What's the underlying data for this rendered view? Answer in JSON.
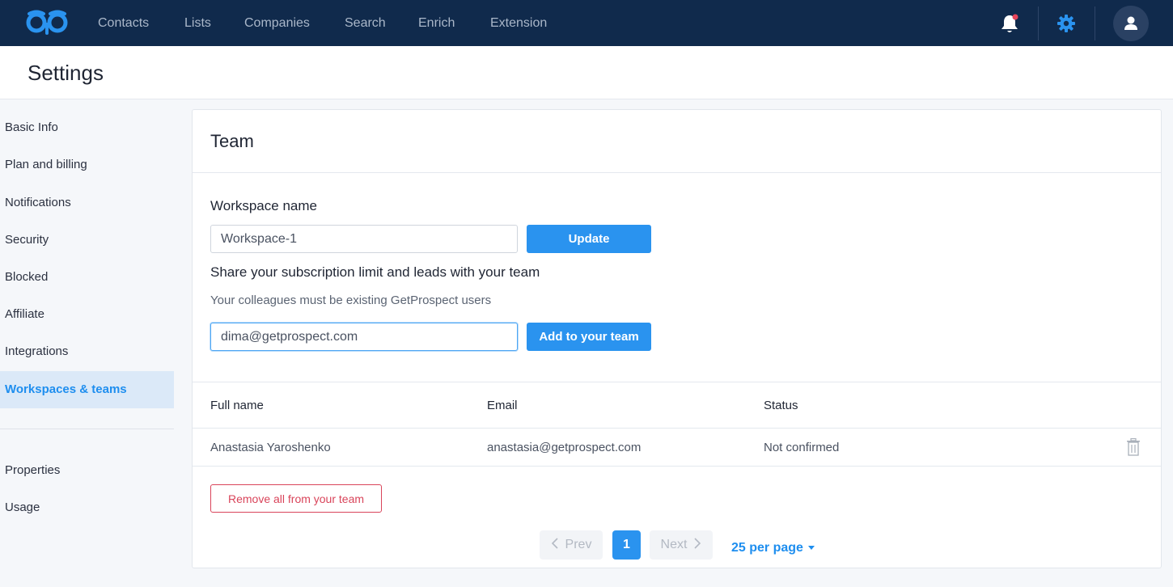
{
  "nav": {
    "items": [
      "Contacts",
      "Lists",
      "Companies",
      "Search",
      "Enrich",
      "Extension"
    ],
    "notification_icon": "bell-icon",
    "settings_icon": "gear-icon",
    "avatar_icon": "user-icon",
    "brand_color": "#102a4c",
    "accent_color": "#2a93ef",
    "notification_dot_color": "#e8445a"
  },
  "page": {
    "title": "Settings"
  },
  "sidebar": {
    "items": [
      "Basic Info",
      "Plan and billing",
      "Notifications",
      "Security",
      "Blocked",
      "Affiliate",
      "Integrations",
      "Workspaces & teams"
    ],
    "active": "Workspaces & teams",
    "secondary_items": [
      "Properties",
      "Usage"
    ]
  },
  "team": {
    "title": "Team",
    "workspace_label": "Workspace name",
    "workspace_value": "Workspace-1",
    "update_label": "Update",
    "share_title": "Share your subscription limit and leads with your team",
    "share_hint": "Your colleagues must be existing GetProspect users",
    "invite_value": "dima@getprospect.com",
    "add_label": "Add to your team",
    "table": {
      "headers": [
        "Full name",
        "Email",
        "Status"
      ],
      "rows": [
        {
          "name": "Anastasia Yaroshenko",
          "email": "anastasia@getprospect.com",
          "status": "Not confirmed"
        }
      ]
    },
    "remove_all_label": "Remove all from your team"
  },
  "pagination": {
    "prev": "Prev",
    "current": "1",
    "next": "Next",
    "per_page": "25 per page"
  }
}
